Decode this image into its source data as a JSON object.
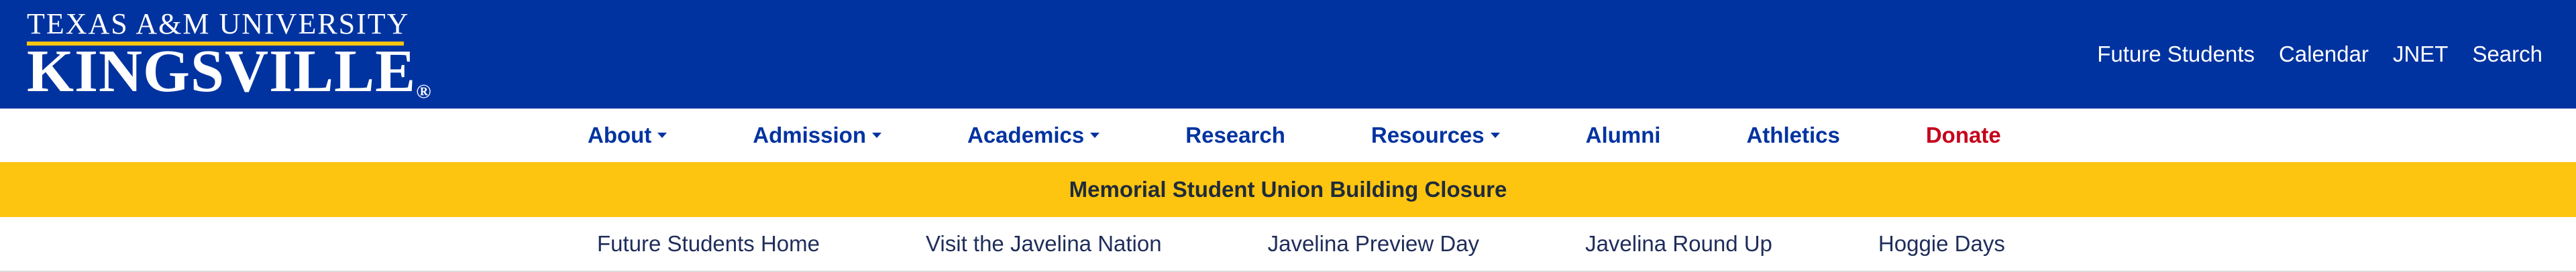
{
  "logo": {
    "line1": "TEXAS A&M UNIVERSITY",
    "line2": "KINGSVILLE",
    "registered": "®"
  },
  "utility_nav": [
    "Future Students",
    "Calendar",
    "JNET",
    "Search"
  ],
  "main_nav": [
    {
      "label": "About",
      "dropdown": true
    },
    {
      "label": "Admission",
      "dropdown": true
    },
    {
      "label": "Academics",
      "dropdown": true
    },
    {
      "label": "Research",
      "dropdown": false
    },
    {
      "label": "Resources",
      "dropdown": true
    },
    {
      "label": "Alumni",
      "dropdown": false
    },
    {
      "label": "Athletics",
      "dropdown": false
    },
    {
      "label": "Donate",
      "dropdown": false
    }
  ],
  "alert": {
    "text": "Memorial Student Union Building Closure"
  },
  "sub_nav": [
    "Future Students Home",
    "Visit the Javelina Nation",
    "Javelina Preview Day",
    "Javelina Round Up",
    "Hoggie Days"
  ],
  "colors": {
    "brand_blue": "#0033a0",
    "brand_gold": "#fdc510",
    "donate_red": "#c5001a"
  }
}
